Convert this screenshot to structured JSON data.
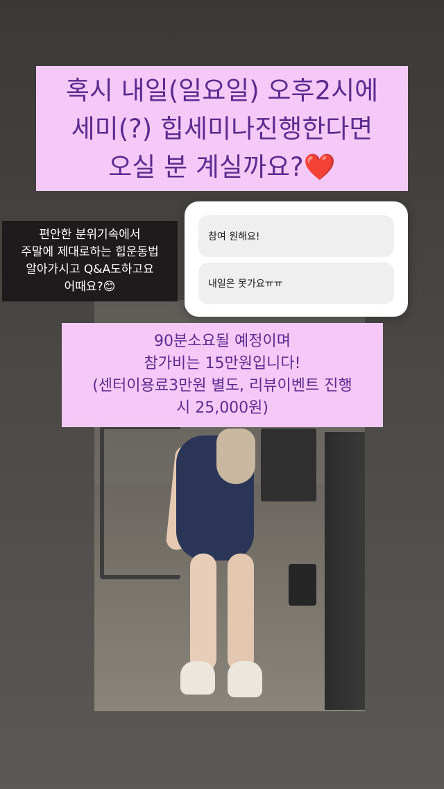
{
  "story": {
    "title_text": "혹시 내일(일요일)  오후2시에\n세미(?) 힙세미나진행한다면\n오실 분 계실까요?❤️",
    "note_text": "편안한 분위기속에서\n주말에 제대로하는 힙운동법\n알아가시고 Q&A도하고요\n어때요?😊",
    "info_text": "90분소요될 예정이며\n참가비는 15만원입니다!\n(센터이용료3만원 별도, 리뷰이벤트 진행\n시 25,000원)"
  },
  "poll": {
    "options": [
      {
        "label": "참여 원해요!"
      },
      {
        "label": "내일은 못가요ㅠㅠ"
      }
    ]
  },
  "colors": {
    "highlight_bg": "#f5c9f7",
    "highlight_text": "#5b2b8f",
    "note_bg": "#1f1b1d"
  }
}
